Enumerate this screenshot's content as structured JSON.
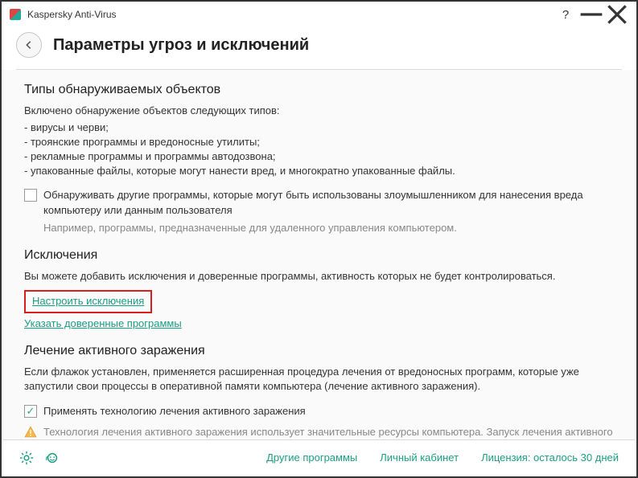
{
  "titlebar": {
    "app_name": "Kaspersky Anti-Virus"
  },
  "header": {
    "page_title": "Параметры угроз и исключений"
  },
  "detect": {
    "section_title": "Типы обнаруживаемых объектов",
    "intro": "Включено обнаружение объектов следующих типов:",
    "items": [
      "- вирусы и черви;",
      "- троянские программы и вредоносные утилиты;",
      "- рекламные программы и программы автодозвона;",
      "- упакованные файлы, которые могут нанести вред, и многократно упакованные файлы."
    ],
    "checkbox_label": "Обнаруживать другие программы, которые могут быть использованы злоумышленником для нанесения вреда компьютеру или данным пользователя",
    "checkbox_hint": "Например, программы, предназначенные для удаленного управления компьютером."
  },
  "exclusions": {
    "section_title": "Исключения",
    "desc": "Вы можете добавить исключения и доверенные программы, активность которых не будет контролироваться.",
    "link_configure": "Настроить исключения",
    "link_trusted": "Указать доверенные программы"
  },
  "active": {
    "section_title": "Лечение активного заражения",
    "desc": "Если флажок установлен, применяется расширенная процедура лечения от вредоносных программ, которые уже запустили свои процессы в оперативной памяти компьютера (лечение активного заражения).",
    "checkbox_label": "Применять технологию лечения активного заражения",
    "warning": "Технология лечения активного заражения использует значительные ресурсы компьютера. Запуск лечения активного заражения может замедлить работу компьютера."
  },
  "footer": {
    "other_programs": "Другие программы",
    "my_account": "Личный кабинет",
    "license": "Лицензия: осталось 30 дней"
  }
}
